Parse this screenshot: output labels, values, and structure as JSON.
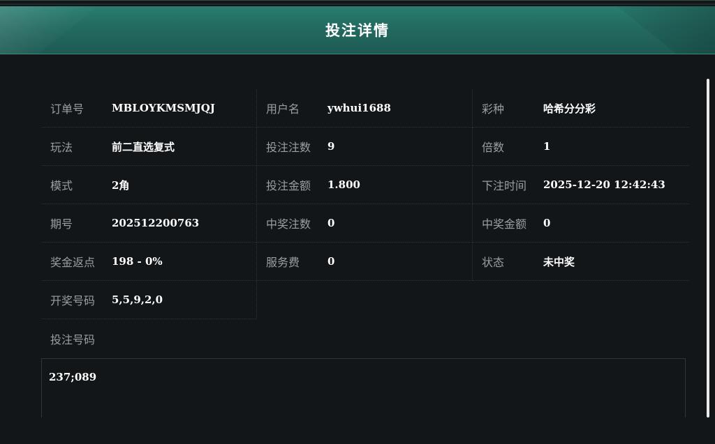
{
  "header": {
    "title": "投注详情"
  },
  "rows": [
    [
      {
        "label": "订单号",
        "value": "MBLOYKMSMJQJ"
      },
      {
        "label": "用户名",
        "value": "ywhui1688"
      },
      {
        "label": "彩种",
        "value": "哈希分分彩"
      }
    ],
    [
      {
        "label": "玩法",
        "value": "前二直选复式"
      },
      {
        "label": "投注注数",
        "value": "9"
      },
      {
        "label": "倍数",
        "value": "1"
      }
    ],
    [
      {
        "label": "模式",
        "value": "2角"
      },
      {
        "label": "投注金额",
        "value": "1.800"
      },
      {
        "label": "下注时间",
        "value": "2025-12-20 12:42:43"
      }
    ],
    [
      {
        "label": "期号",
        "value": "202512200763"
      },
      {
        "label": "中奖注数",
        "value": "0"
      },
      {
        "label": "中奖金额",
        "value": "0"
      }
    ],
    [
      {
        "label": "奖金返点",
        "value": "198 - 0%"
      },
      {
        "label": "服务费",
        "value": "0"
      },
      {
        "label": "状态",
        "value": "未中奖"
      }
    ]
  ],
  "draw": {
    "label": "开奖号码",
    "value": "5,5,9,2,0"
  },
  "bet": {
    "label": "投注号码",
    "value": "237;089"
  }
}
